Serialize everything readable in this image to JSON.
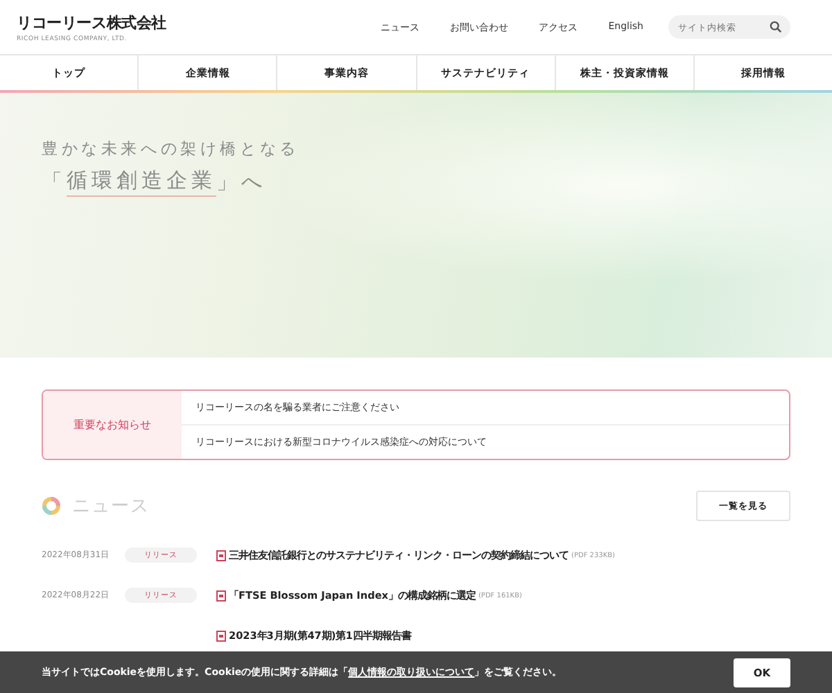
{
  "header": {
    "logo": "リコーリース株式会社",
    "logo_sub": "RICOH LEASING COMPANY, LTD.",
    "links": [
      "ニュース",
      "お問い合わせ",
      "アクセス",
      "English"
    ],
    "search": {
      "placeholder": "サイト内検索"
    }
  },
  "nav": [
    "トップ",
    "企業情報",
    "事業内容",
    "サステナビリティ",
    "株主・投資家情報",
    "採用情報"
  ],
  "hero": {
    "line1": "豊かな未来への架け橋となる",
    "line2_open": "「",
    "line2_main": "循環創造企業",
    "line2_close": "」へ"
  },
  "notice": {
    "label": "重要なお知らせ",
    "items": [
      "リコーリースの名を騙る業者にご注意ください",
      "リコーリースにおける新型コロナウイルス感染症への対応について"
    ]
  },
  "news": {
    "title": "ニュース",
    "more": "一覧を見る",
    "items": [
      {
        "date": "2022年08月31日",
        "tag": "リリース",
        "title": "三井住友信託銀行とのサステナビリティ・リンク・ローンの契約締結について",
        "size": "(PDF 233KB)"
      },
      {
        "date": "2022年08月22日",
        "tag": "リリース",
        "title": "「FTSE Blossom Japan Index」の構成銘柄に選定",
        "size": "(PDF 161KB)"
      },
      {
        "title": "2023年3月期(第47期)第1四半期報告書"
      }
    ]
  },
  "cookie": {
    "text_before": "当サイトではCookieを使用します。Cookieの使用に関する詳細は「",
    "link": "個人情報の取り扱いについて",
    "text_after": "」をご覧ください。",
    "ok": "OK"
  }
}
